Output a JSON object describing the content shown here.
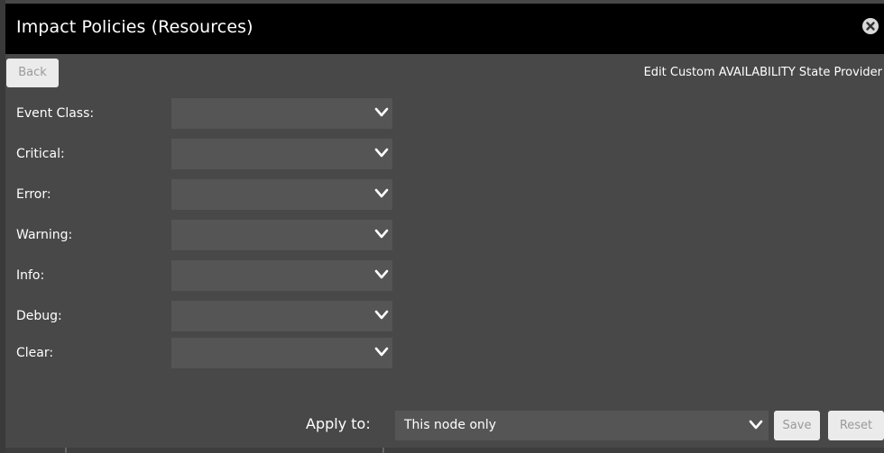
{
  "dialog": {
    "title": "Impact Policies (Resources)",
    "close_icon": "close-circle-icon"
  },
  "topbar": {
    "back_label": "Back",
    "panel_title": "Edit Custom AVAILABILITY State Provider"
  },
  "form": {
    "rows": [
      {
        "label": "Event Class:",
        "value": ""
      },
      {
        "label": "Critical:",
        "value": ""
      },
      {
        "label": "Error:",
        "value": ""
      },
      {
        "label": "Warning:",
        "value": ""
      },
      {
        "label": "Info:",
        "value": ""
      },
      {
        "label": "Debug:",
        "value": ""
      },
      {
        "label": "Clear:",
        "value": ""
      }
    ]
  },
  "footer": {
    "apply_label": "Apply to:",
    "apply_value": "This node only",
    "save_label": "Save",
    "reset_label": "Reset"
  },
  "colors": {
    "titlebar": "#000000",
    "panel": "#484848",
    "field": "#555555",
    "button": "#ebebeb"
  }
}
